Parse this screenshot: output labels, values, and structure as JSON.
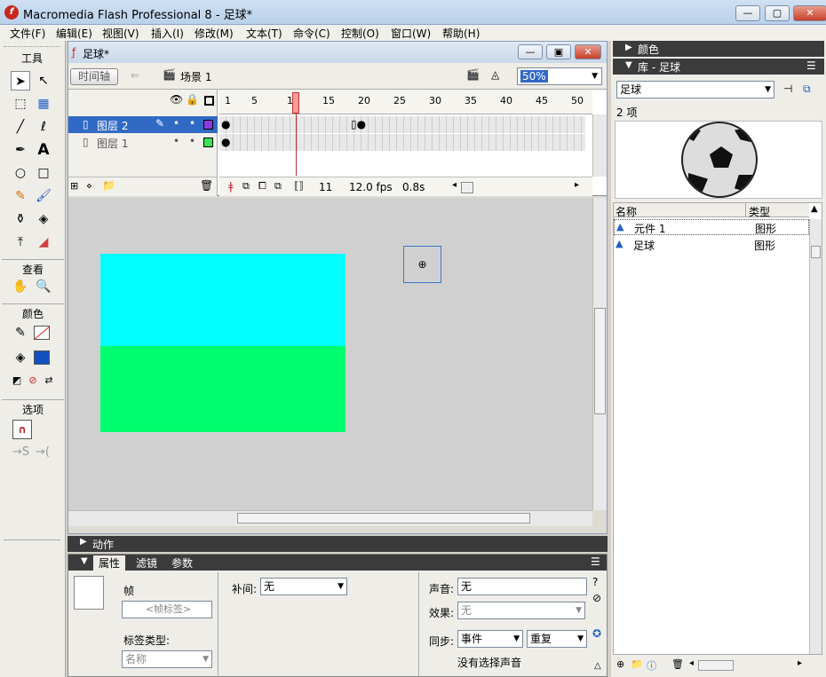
{
  "window": {
    "title": "Macromedia Flash Professional 8 - 足球*",
    "icon": "flash-app-icon"
  },
  "menu": [
    "文件(F)",
    "编辑(E)",
    "视图(V)",
    "插入(I)",
    "修改(M)",
    "文本(T)",
    "命令(C)",
    "控制(O)",
    "窗口(W)",
    "帮助(H)"
  ],
  "toolbox": {
    "title": "工具",
    "view_label": "查看",
    "colors_label": "颜色",
    "options_label": "选项"
  },
  "document": {
    "title": "足球*",
    "timeline_btn": "时间轴",
    "scene": "场景 1",
    "zoom": "50%",
    "layers": [
      {
        "name": "图层 2",
        "selected": true,
        "color": "#8a3be0"
      },
      {
        "name": "图层 1",
        "selected": false,
        "color": "#3ce05a"
      }
    ],
    "ruler": [
      "1",
      "5",
      "10",
      "15",
      "20",
      "25",
      "30",
      "35",
      "40",
      "45",
      "50"
    ],
    "current_frame": "11",
    "fps": "12.0 fps",
    "time": "0.8s"
  },
  "stage": {
    "top_color": "#00ffff",
    "bottom_color": "#00ff6e"
  },
  "panels": {
    "actions": "动作",
    "props_tab": "属性",
    "filters_tab": "滤镜",
    "params_tab": "参数"
  },
  "props": {
    "frame_label": "帧",
    "frame_placeholder": "<帧标签>",
    "tween_label": "补间:",
    "tween_value": "无",
    "label_type": "标签类型:",
    "label_type_value": "名称",
    "sound_label": "声音:",
    "sound_value": "无",
    "effect_label": "效果:",
    "effect_value": "无",
    "sync_label": "同步:",
    "sync_value": "事件",
    "repeat_value": "重复",
    "no_sound": "没有选择声音"
  },
  "library": {
    "colors_panel": "颜色",
    "title": "库 - 足球",
    "doc": "足球",
    "count": "2 项",
    "col_name": "名称",
    "col_type": "类型",
    "items": [
      {
        "name": "元件 1",
        "type": "图形"
      },
      {
        "name": "足球",
        "type": "图形"
      }
    ]
  }
}
